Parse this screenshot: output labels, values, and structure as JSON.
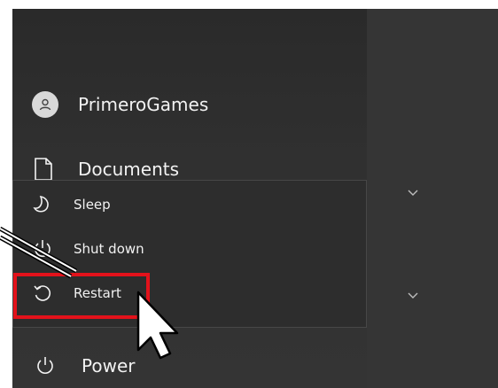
{
  "start_menu": {
    "user": {
      "name": "PrimeroGames",
      "icon": "person-icon"
    },
    "documents": {
      "label": "Documents",
      "icon": "document-icon"
    },
    "power": {
      "label": "Power",
      "icon": "power-icon"
    }
  },
  "power_menu": {
    "items": [
      {
        "label": "Sleep",
        "icon": "sleep-moon-icon"
      },
      {
        "label": "Shut down",
        "icon": "shutdown-icon"
      },
      {
        "label": "Restart",
        "icon": "restart-icon"
      }
    ],
    "highlighted": "Restart"
  },
  "colors": {
    "highlight_box": "#e3121b",
    "menu_background": "#2d2d2d",
    "text": "#f2f2f2"
  }
}
